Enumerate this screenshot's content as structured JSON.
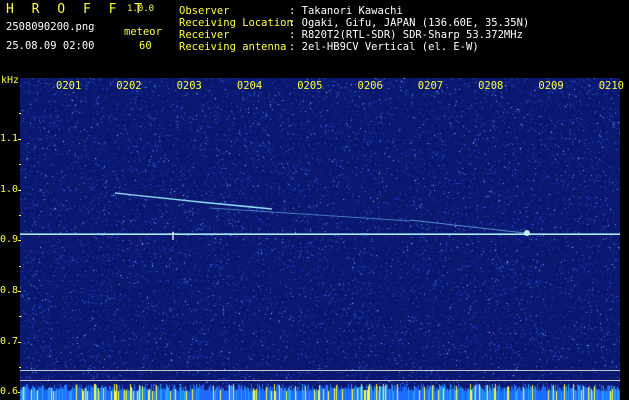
{
  "header": {
    "logo": "H R O F F T",
    "version": "1.0.0",
    "filename": "2508090200.png",
    "datetime": "25.08.09 02:00",
    "meteor_label": "meteor",
    "meteor_count": "60"
  },
  "info": [
    {
      "label": "Observer",
      "value": ": Takanori Kawachi"
    },
    {
      "label": "Receiving Location",
      "value": ": Ogaki, Gifu, JAPAN (136.60E, 35.35N)"
    },
    {
      "label": "Receiver",
      "value": ": R820T2(RTL-SDR) SDR-Sharp 53.372MHz"
    },
    {
      "label": "Receiving antenna",
      "value": ": 2el-HB9CV Vertical (el. E-W)"
    }
  ],
  "spectrogram": {
    "y_unit": "kHz",
    "y_ticks": [
      "1.1",
      "1.0",
      "0.9",
      "0.8",
      "0.7",
      "0.6"
    ],
    "y_range": [
      0.585,
      1.22
    ],
    "x_ticks": [
      "0201",
      "0202",
      "0203",
      "0204",
      "0205",
      "0206",
      "0207",
      "0208",
      "0209",
      "0210"
    ],
    "carrier_khz": 0.912,
    "colors": {
      "background": "#0b1870",
      "axis_text": "#ffff33",
      "trace": "#9ef0ff"
    }
  }
}
